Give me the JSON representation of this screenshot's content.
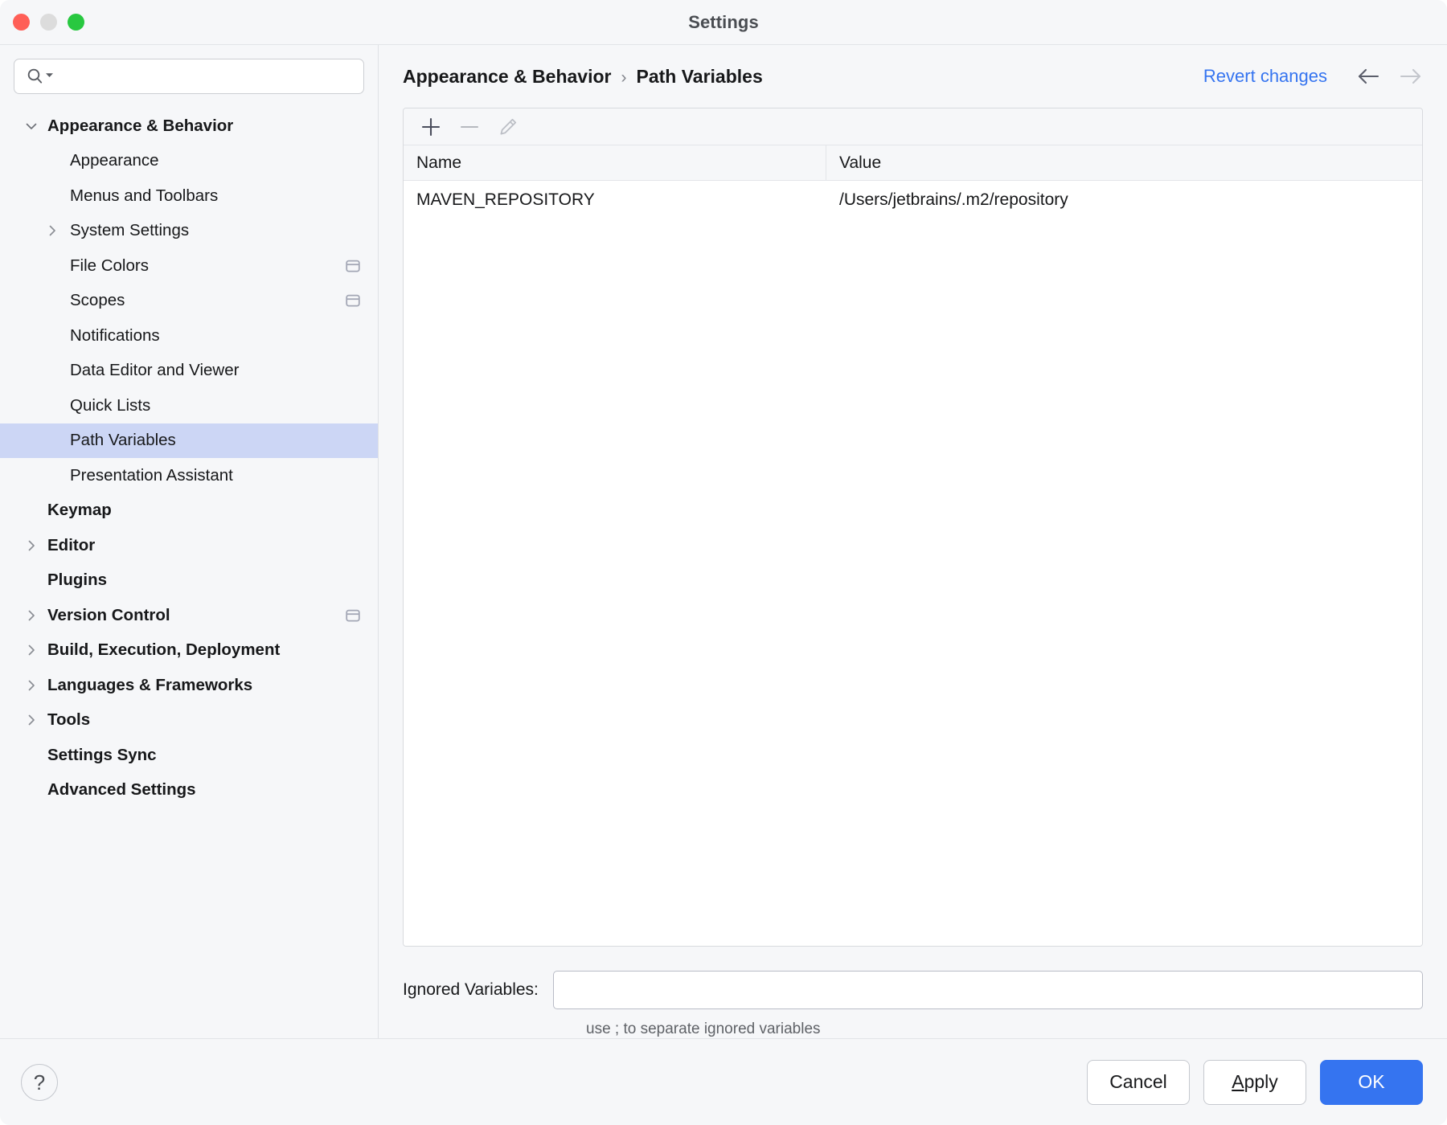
{
  "window": {
    "title": "Settings",
    "traffic_lights": [
      "close-button",
      "minimize-button",
      "maximize-button"
    ]
  },
  "sidebar": {
    "search": {
      "value": "",
      "placeholder": "",
      "icon": "search-icon",
      "dropdown_icon": "chevron-down-icon"
    },
    "items": [
      {
        "label": "Appearance & Behavior",
        "level": 0,
        "bold": true,
        "twisty": "chevron-down",
        "selected": false,
        "badge": false
      },
      {
        "label": "Appearance",
        "level": 1,
        "bold": false,
        "twisty": "none",
        "selected": false,
        "badge": false
      },
      {
        "label": "Menus and Toolbars",
        "level": 1,
        "bold": false,
        "twisty": "none",
        "selected": false,
        "badge": false
      },
      {
        "label": "System Settings",
        "level": 1,
        "bold": false,
        "twisty": "chevron-right",
        "selected": false,
        "badge": false
      },
      {
        "label": "File Colors",
        "level": 1,
        "bold": false,
        "twisty": "none",
        "selected": false,
        "badge": true
      },
      {
        "label": "Scopes",
        "level": 1,
        "bold": false,
        "twisty": "none",
        "selected": false,
        "badge": true
      },
      {
        "label": "Notifications",
        "level": 1,
        "bold": false,
        "twisty": "none",
        "selected": false,
        "badge": false
      },
      {
        "label": "Data Editor and Viewer",
        "level": 1,
        "bold": false,
        "twisty": "none",
        "selected": false,
        "badge": false
      },
      {
        "label": "Quick Lists",
        "level": 1,
        "bold": false,
        "twisty": "none",
        "selected": false,
        "badge": false
      },
      {
        "label": "Path Variables",
        "level": 1,
        "bold": false,
        "twisty": "none",
        "selected": true,
        "badge": false
      },
      {
        "label": "Presentation Assistant",
        "level": 1,
        "bold": false,
        "twisty": "none",
        "selected": false,
        "badge": false
      },
      {
        "label": "Keymap",
        "level": 0,
        "bold": true,
        "twisty": "none",
        "selected": false,
        "badge": false
      },
      {
        "label": "Editor",
        "level": 0,
        "bold": true,
        "twisty": "chevron-right",
        "selected": false,
        "badge": false
      },
      {
        "label": "Plugins",
        "level": 0,
        "bold": true,
        "twisty": "none",
        "selected": false,
        "badge": false
      },
      {
        "label": "Version Control",
        "level": 0,
        "bold": true,
        "twisty": "chevron-right",
        "selected": false,
        "badge": true
      },
      {
        "label": "Build, Execution, Deployment",
        "level": 0,
        "bold": true,
        "twisty": "chevron-right",
        "selected": false,
        "badge": false
      },
      {
        "label": "Languages & Frameworks",
        "level": 0,
        "bold": true,
        "twisty": "chevron-right",
        "selected": false,
        "badge": false
      },
      {
        "label": "Tools",
        "level": 0,
        "bold": true,
        "twisty": "chevron-right",
        "selected": false,
        "badge": false
      },
      {
        "label": "Settings Sync",
        "level": 0,
        "bold": true,
        "twisty": "none",
        "selected": false,
        "badge": false
      },
      {
        "label": "Advanced Settings",
        "level": 0,
        "bold": true,
        "twisty": "none",
        "selected": false,
        "badge": false
      }
    ]
  },
  "main": {
    "breadcrumb": {
      "parent": "Appearance & Behavior",
      "separator": "›",
      "current": "Path Variables"
    },
    "revert_label": "Revert changes",
    "nav": {
      "back_icon": "arrow-left-icon",
      "forward_icon": "arrow-right-icon",
      "back_enabled": true,
      "forward_enabled": false
    },
    "toolbar": {
      "add": {
        "icon": "plus-icon",
        "enabled": true
      },
      "remove": {
        "icon": "minus-icon",
        "enabled": false
      },
      "edit": {
        "icon": "pencil-icon",
        "enabled": false
      }
    },
    "table": {
      "columns": [
        "Name",
        "Value"
      ],
      "rows": [
        {
          "name": "MAVEN_REPOSITORY",
          "value": "/Users/jetbrains/.m2/repository"
        }
      ]
    },
    "ignored": {
      "label": "Ignored Variables:",
      "value": "",
      "placeholder": "",
      "hint": "use ; to separate ignored variables"
    }
  },
  "footer": {
    "help_label": "?",
    "cancel_label": "Cancel",
    "apply_mnemonic": "A",
    "apply_rest": "pply",
    "ok_label": "OK"
  },
  "colors": {
    "accent": "#3574f0",
    "selection": "#ccd6f5",
    "panel_bg": "#f6f7f9",
    "field_bg": "#ffffff",
    "text": "#17181a",
    "badge": "#a3a7b5"
  }
}
